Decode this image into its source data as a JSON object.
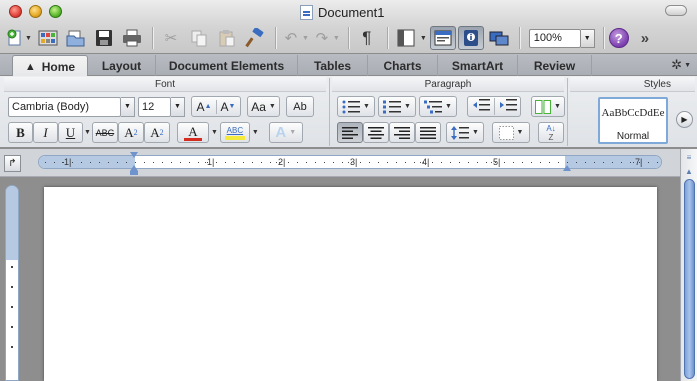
{
  "window": {
    "title": "Document1"
  },
  "toolbar": {
    "zoom_value": "100%"
  },
  "tabs": [
    {
      "label": "Home",
      "active": true
    },
    {
      "label": "Layout"
    },
    {
      "label": "Document Elements"
    },
    {
      "label": "Tables"
    },
    {
      "label": "Charts"
    },
    {
      "label": "SmartArt"
    },
    {
      "label": "Review"
    }
  ],
  "ribbon": {
    "font_group": "Font",
    "paragraph_group": "Paragraph",
    "styles_group": "Styles",
    "font_name": "Cambria (Body)",
    "font_size": "12",
    "bold": "B",
    "italic": "I",
    "underline": "U",
    "strike": "ABC",
    "superscript": "A",
    "superscript_mark": "2",
    "subscript": "A",
    "subscript_mark": "2",
    "grow_font": "A",
    "shrink_font": "A",
    "change_case": "Aa",
    "clear_format_letters": "Ab",
    "font_color_letter": "A",
    "highlight_letters": "ABC",
    "text_effects_letter": "A",
    "style_sample": "AaBbCcDdEe",
    "style_name": "Normal"
  },
  "ruler": {
    "labels": [
      "1",
      "1",
      "2",
      "3",
      "4",
      "5",
      "7"
    ]
  },
  "colors": {
    "accent": "#3a6cc0",
    "font_color": "#d62b1f",
    "highlight": "#f3ea3c"
  }
}
